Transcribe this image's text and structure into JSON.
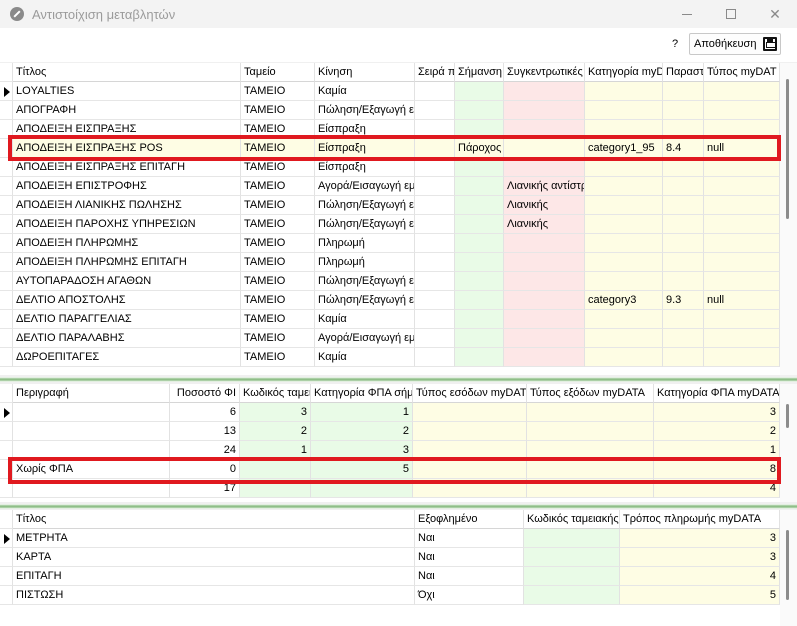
{
  "window": {
    "title": "Αντιστοίχιση μεταβλητών"
  },
  "toolbar": {
    "help_label": "?",
    "save_label": "Αποθήκευση"
  },
  "top_grid": {
    "columns": [
      "Τίτλος",
      "Ταμείο",
      "Κίνηση",
      "Σειρά π",
      "Σήμανση",
      "Συγκεντρωτικές",
      "Κατηγορία myDA",
      "Παραστ",
      "Τύπος myDAT"
    ],
    "rows": [
      [
        "LOYALTIES",
        "ΤΑΜΕΙΟ",
        "Καμία",
        "",
        "",
        "",
        "",
        "",
        ""
      ],
      [
        "ΑΠΟΓΡΑΦΗ",
        "ΤΑΜΕΙΟ",
        "Πώληση/Εξαγωγή ε",
        "",
        "",
        "",
        "",
        "",
        ""
      ],
      [
        "ΑΠΟΔΕΙΞΗ ΕΙΣΠΡΑΞΗΣ",
        "ΤΑΜΕΙΟ",
        "Είσπραξη",
        "",
        "",
        "",
        "",
        "",
        ""
      ],
      [
        "ΑΠΟΔΕΙΞΗ ΕΙΣΠΡΑΞΗΣ POS",
        "ΤΑΜΕΙΟ",
        "Είσπραξη",
        "",
        "Πάροχος",
        "",
        "category1_95",
        "8.4",
        "null"
      ],
      [
        "ΑΠΟΔΕΙΞΗ ΕΙΣΠΡΑΞΗΣ ΕΠΙΤΑΓΗ",
        "ΤΑΜΕΙΟ",
        "Είσπραξη",
        "",
        "",
        "",
        "",
        "",
        ""
      ],
      [
        "ΑΠΟΔΕΙΞΗ ΕΠΙΣΤΡΟΦΗΣ",
        "ΤΑΜΕΙΟ",
        "Αγορά/Εισαγωγή εμ",
        "",
        "",
        "Λιανικής αντίστρ",
        "",
        "",
        ""
      ],
      [
        "ΑΠΟΔΕΙΞΗ ΛΙΑΝΙΚΗΣ ΠΩΛΗΣΗΣ",
        "ΤΑΜΕΙΟ",
        "Πώληση/Εξαγωγή ε",
        "",
        "",
        "Λιανικής",
        "",
        "",
        ""
      ],
      [
        "ΑΠΟΔΕΙΞΗ ΠΑΡΟΧΗΣ ΥΠΗΡΕΣΙΩΝ",
        "ΤΑΜΕΙΟ",
        "Πώληση/Εξαγωγή ε",
        "",
        "",
        "Λιανικής",
        "",
        "",
        ""
      ],
      [
        "ΑΠΟΔΕΙΞΗ ΠΛΗΡΩΜΗΣ",
        "ΤΑΜΕΙΟ",
        "Πληρωμή",
        "",
        "",
        "",
        "",
        "",
        ""
      ],
      [
        "ΑΠΟΔΕΙΞΗ ΠΛΗΡΩΜΗΣ ΕΠΙΤΑΓΗ",
        "ΤΑΜΕΙΟ",
        "Πληρωμή",
        "",
        "",
        "",
        "",
        "",
        ""
      ],
      [
        "ΑΥΤΟΠΑΡΑΔΟΣΗ ΑΓΑΘΩΝ",
        "ΤΑΜΕΙΟ",
        "Πώληση/Εξαγωγή ε",
        "",
        "",
        "",
        "",
        "",
        ""
      ],
      [
        "ΔΕΛΤΙΟ ΑΠΟΣΤΟΛΗΣ",
        "ΤΑΜΕΙΟ",
        "Πώληση/Εξαγωγή ε",
        "",
        "",
        "",
        "category3",
        "9.3",
        "null"
      ],
      [
        "ΔΕΛΤΙΟ ΠΑΡΑΓΓΕΛΙΑΣ",
        "ΤΑΜΕΙΟ",
        "Καμία",
        "",
        "",
        "",
        "",
        "",
        ""
      ],
      [
        "ΔΕΛΤΙΟ ΠΑΡΑΛΑΒΗΣ",
        "ΤΑΜΕΙΟ",
        "Αγορά/Εισαγωγή εμ",
        "",
        "",
        "",
        "",
        "",
        ""
      ],
      [
        "ΔΩΡΟΕΠΙΤΑΓΕΣ",
        "ΤΑΜΕΙΟ",
        "Καμία",
        "",
        "",
        "",
        "",
        "",
        ""
      ]
    ]
  },
  "mid_grid": {
    "columns": [
      "Περιγραφή",
      "Ποσοστό ΦΙ",
      "Κωδικός ταμει",
      "Κατηγορία ΦΠΑ σήμ",
      "Τύπος εσόδων myDAT",
      "Τύπος εξόδων myDATA",
      "Κατηγορία ΦΠΑ myDATA"
    ],
    "rows": [
      [
        "",
        "6",
        "3",
        "1",
        "",
        "",
        "3"
      ],
      [
        "",
        "13",
        "2",
        "2",
        "",
        "",
        "2"
      ],
      [
        "",
        "24",
        "1",
        "3",
        "",
        "",
        "1"
      ],
      [
        "Χωρίς ΦΠΑ",
        "0",
        "",
        "5",
        "",
        "",
        "8"
      ],
      [
        "",
        "17",
        "",
        "",
        "",
        "",
        "4"
      ]
    ]
  },
  "bottom_grid": {
    "columns": [
      "Τίτλος",
      "Εξοφλημένο",
      "Κωδικός ταμειακής",
      "Τρόπος πληρωμής myDATA"
    ],
    "rows": [
      [
        "ΜΕΤΡΗΤΑ",
        "Ναι",
        "",
        "3"
      ],
      [
        "ΚΑΡΤΑ",
        "Ναι",
        "",
        "3"
      ],
      [
        "ΕΠΙΤΑΓΗ",
        "Ναι",
        "",
        "4"
      ],
      [
        "ΠΙΣΤΩΣΗ",
        "Όχι",
        "",
        "5"
      ]
    ]
  },
  "colors": {
    "highlight": "#e0191f",
    "green_cell": "#e9fbe7",
    "pink_cell": "#fde7e7",
    "yellow_cell": "#fefde4"
  }
}
